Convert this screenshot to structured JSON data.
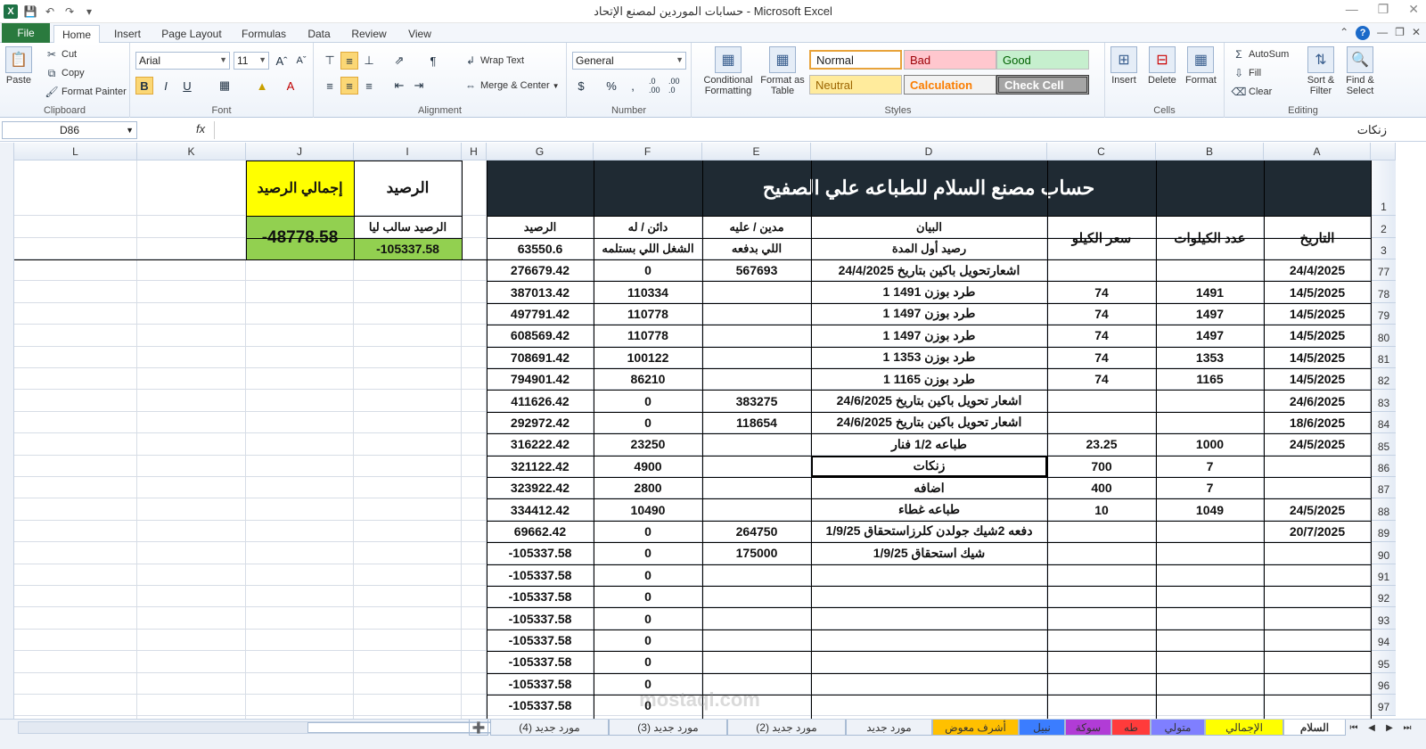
{
  "window": {
    "title": "حسابات الموردين لمصنع الإتحاد - Microsoft Excel"
  },
  "ribbon_tabs": [
    "File",
    "Home",
    "Insert",
    "Page Layout",
    "Formulas",
    "Data",
    "Review",
    "View"
  ],
  "clipboard": {
    "paste": "Paste",
    "cut": "Cut",
    "copy": "Copy",
    "format_painter": "Format Painter",
    "label": "Clipboard"
  },
  "font": {
    "name": "Arial",
    "size": "11",
    "bold": "B",
    "italic": "I",
    "underline": "U",
    "label": "Font"
  },
  "alignment": {
    "wrap_text": "Wrap Text",
    "merge_center": "Merge & Center",
    "label": "Alignment"
  },
  "number": {
    "format": "General",
    "currency": "$",
    "percent": "%",
    "comma": ",",
    "inc_dec": ".0 .00",
    "dec_dec": ".00 .0",
    "label": "Number"
  },
  "styles": {
    "conditional": "Conditional Formatting",
    "format_table": "Format as Table",
    "normal": "Normal",
    "bad": "Bad",
    "good": "Good",
    "neutral": "Neutral",
    "calculation": "Calculation",
    "check_cell": "Check Cell",
    "label": "Styles"
  },
  "cells_group": {
    "insert": "Insert",
    "delete": "Delete",
    "format": "Format",
    "label": "Cells"
  },
  "editing": {
    "autosum": "AutoSum",
    "fill": "Fill",
    "clear": "Clear",
    "sort_filter": "Sort & Filter",
    "find_select": "Find & Select",
    "label": "Editing"
  },
  "formula_bar": {
    "name_box": "D86",
    "fx": "fx",
    "content": "زنكات"
  },
  "columns": [
    "L",
    "K",
    "J",
    "I",
    "H",
    "G",
    "F",
    "E",
    "D",
    "C",
    "B",
    "A"
  ],
  "sheet": {
    "main_title": "حساب مصنع السلام للطباعه علي الصفيح",
    "headers": {
      "date": "التاريخ",
      "kilos": "عدد الكيلوات",
      "kilo_price": "سعر الكيلو",
      "statement": "البيان",
      "debit": "مدين / عليه",
      "credit": "دائن / له",
      "balance": "الرصيد"
    },
    "subheaders": {
      "statement": "رصيد أول المدة",
      "debit": "اللي بدفعه",
      "credit": "الشغل اللي بستلمه",
      "balance": "63550.6"
    },
    "summary": {
      "balance_title": "الرصيد",
      "total_title": "إجمالي الرصيد",
      "negative_label": "الرصيد سالب ليا",
      "balance_value": "-105337.58",
      "total_value": "-48778.58"
    },
    "rows": [
      {
        "num": "77",
        "date": "24/4/2025",
        "kilos": "",
        "price": "",
        "statement": "اشعارتحويل باكين بتاريخ 24/4/2025",
        "debit": "567693",
        "credit": "0",
        "balance": "276679.42"
      },
      {
        "num": "78",
        "date": "14/5/2025",
        "kilos": "1491",
        "price": "74",
        "statement": "1 طرد بوزن 1491",
        "debit": "",
        "credit": "110334",
        "balance": "387013.42"
      },
      {
        "num": "79",
        "date": "14/5/2025",
        "kilos": "1497",
        "price": "74",
        "statement": "1 طرد بوزن 1497",
        "debit": "",
        "credit": "110778",
        "balance": "497791.42"
      },
      {
        "num": "80",
        "date": "14/5/2025",
        "kilos": "1497",
        "price": "74",
        "statement": "1 طرد بوزن 1497",
        "debit": "",
        "credit": "110778",
        "balance": "608569.42"
      },
      {
        "num": "81",
        "date": "14/5/2025",
        "kilos": "1353",
        "price": "74",
        "statement": "1 طرد بوزن 1353",
        "debit": "",
        "credit": "100122",
        "balance": "708691.42"
      },
      {
        "num": "82",
        "date": "14/5/2025",
        "kilos": "1165",
        "price": "74",
        "statement": "1 طرد بوزن 1165",
        "debit": "",
        "credit": "86210",
        "balance": "794901.42"
      },
      {
        "num": "83",
        "date": "24/6/2025",
        "kilos": "",
        "price": "",
        "statement": "اشعار تحويل باكين بتاريخ 24/6/2025",
        "debit": "383275",
        "credit": "0",
        "balance": "411626.42"
      },
      {
        "num": "84",
        "date": "18/6/2025",
        "kilos": "",
        "price": "",
        "statement": "اشعار تحويل باكين بتاريخ 24/6/2025",
        "debit": "118654",
        "credit": "0",
        "balance": "292972.42"
      },
      {
        "num": "85",
        "date": "24/5/2025",
        "kilos": "1000",
        "price": "23.25",
        "statement": "طباعه 1/2 فنار",
        "debit": "",
        "credit": "23250",
        "balance": "316222.42"
      },
      {
        "num": "86",
        "date": "",
        "kilos": "7",
        "price": "700",
        "statement": "زنكات",
        "debit": "",
        "credit": "4900",
        "balance": "321122.42"
      },
      {
        "num": "87",
        "date": "",
        "kilos": "7",
        "price": "400",
        "statement": "اضافه",
        "debit": "",
        "credit": "2800",
        "balance": "323922.42"
      },
      {
        "num": "88",
        "date": "24/5/2025",
        "kilos": "1049",
        "price": "10",
        "statement": "طباعه غطاء",
        "debit": "",
        "credit": "10490",
        "balance": "334412.42"
      },
      {
        "num": "89",
        "date": "20/7/2025",
        "kilos": "",
        "price": "",
        "statement": "دفعه 2شيك جولدن كلرزاستحقاق 1/9/25",
        "debit": "264750",
        "credit": "0",
        "balance": "69662.42"
      },
      {
        "num": "90",
        "date": "",
        "kilos": "",
        "price": "",
        "statement": "شيك استحقاق 1/9/25",
        "debit": "175000",
        "credit": "0",
        "balance": "-105337.58"
      },
      {
        "num": "91",
        "date": "",
        "kilos": "",
        "price": "",
        "statement": "",
        "debit": "",
        "credit": "0",
        "balance": "-105337.58"
      },
      {
        "num": "92",
        "date": "",
        "kilos": "",
        "price": "",
        "statement": "",
        "debit": "",
        "credit": "0",
        "balance": "-105337.58"
      },
      {
        "num": "93",
        "date": "",
        "kilos": "",
        "price": "",
        "statement": "",
        "debit": "",
        "credit": "0",
        "balance": "-105337.58"
      },
      {
        "num": "94",
        "date": "",
        "kilos": "",
        "price": "",
        "statement": "",
        "debit": "",
        "credit": "0",
        "balance": "-105337.58"
      },
      {
        "num": "95",
        "date": "",
        "kilos": "",
        "price": "",
        "statement": "",
        "debit": "",
        "credit": "0",
        "balance": "-105337.58"
      },
      {
        "num": "96",
        "date": "",
        "kilos": "",
        "price": "",
        "statement": "",
        "debit": "",
        "credit": "0",
        "balance": "-105337.58"
      },
      {
        "num": "97",
        "date": "",
        "kilos": "",
        "price": "",
        "statement": "",
        "debit": "",
        "credit": "0",
        "balance": "-105337.58"
      }
    ],
    "header_row_nums": [
      "1",
      "2",
      "3"
    ]
  },
  "sheet_tabs": [
    {
      "label": "السلام",
      "color": "#ffffff",
      "active": true
    },
    {
      "label": "الإجمالي",
      "color": "#ffff00"
    },
    {
      "label": "متولي",
      "color": "#7f7fff"
    },
    {
      "label": "طه",
      "color": "#ff3b3b"
    },
    {
      "label": "سوكة",
      "color": "#b13cd6"
    },
    {
      "label": "نبيل",
      "color": "#3b7dff"
    },
    {
      "label": "أشرف معوض",
      "color": "#ffc000"
    },
    {
      "label": "مورد جديد",
      "color": "#eef2f8"
    },
    {
      "label": "مورد جديد (2)",
      "color": "#eef2f8"
    },
    {
      "label": "مورد جديد (3)",
      "color": "#eef2f8"
    },
    {
      "label": "مورد جديد (4)",
      "color": "#eef2f8"
    }
  ],
  "watermark": {
    "text": "mostaql.com"
  }
}
